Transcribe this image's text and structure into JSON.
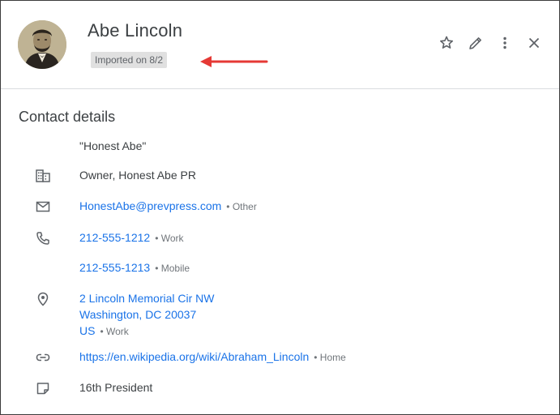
{
  "header": {
    "name": "Abe Lincoln",
    "label_chip": "Imported on 8/2",
    "icons": [
      "star-icon",
      "pencil-icon",
      "more-vert-icon",
      "close-icon"
    ]
  },
  "details": {
    "title": "Contact details",
    "nickname": "\"Honest Abe\"",
    "job": "Owner, Honest Abe PR",
    "email": {
      "value": "HonestAbe@prevpress.com",
      "type": "• Other"
    },
    "phones": [
      {
        "value": "212-555-1212",
        "type": "• Work"
      },
      {
        "value": "212-555-1213",
        "type": "• Mobile"
      }
    ],
    "address": {
      "line1": "2 Lincoln Memorial Cir NW",
      "line2": "Washington, DC 20037",
      "line3": "US",
      "type": "• Work"
    },
    "website": {
      "value": "https://en.wikipedia.org/wiki/Abraham_Lincoln",
      "type": "• Home"
    },
    "note": "16th President"
  },
  "colors": {
    "link": "#1a73e8",
    "arrow": "#e53935",
    "chip_bg": "#e0e0e0",
    "icon": "#5f6368"
  }
}
